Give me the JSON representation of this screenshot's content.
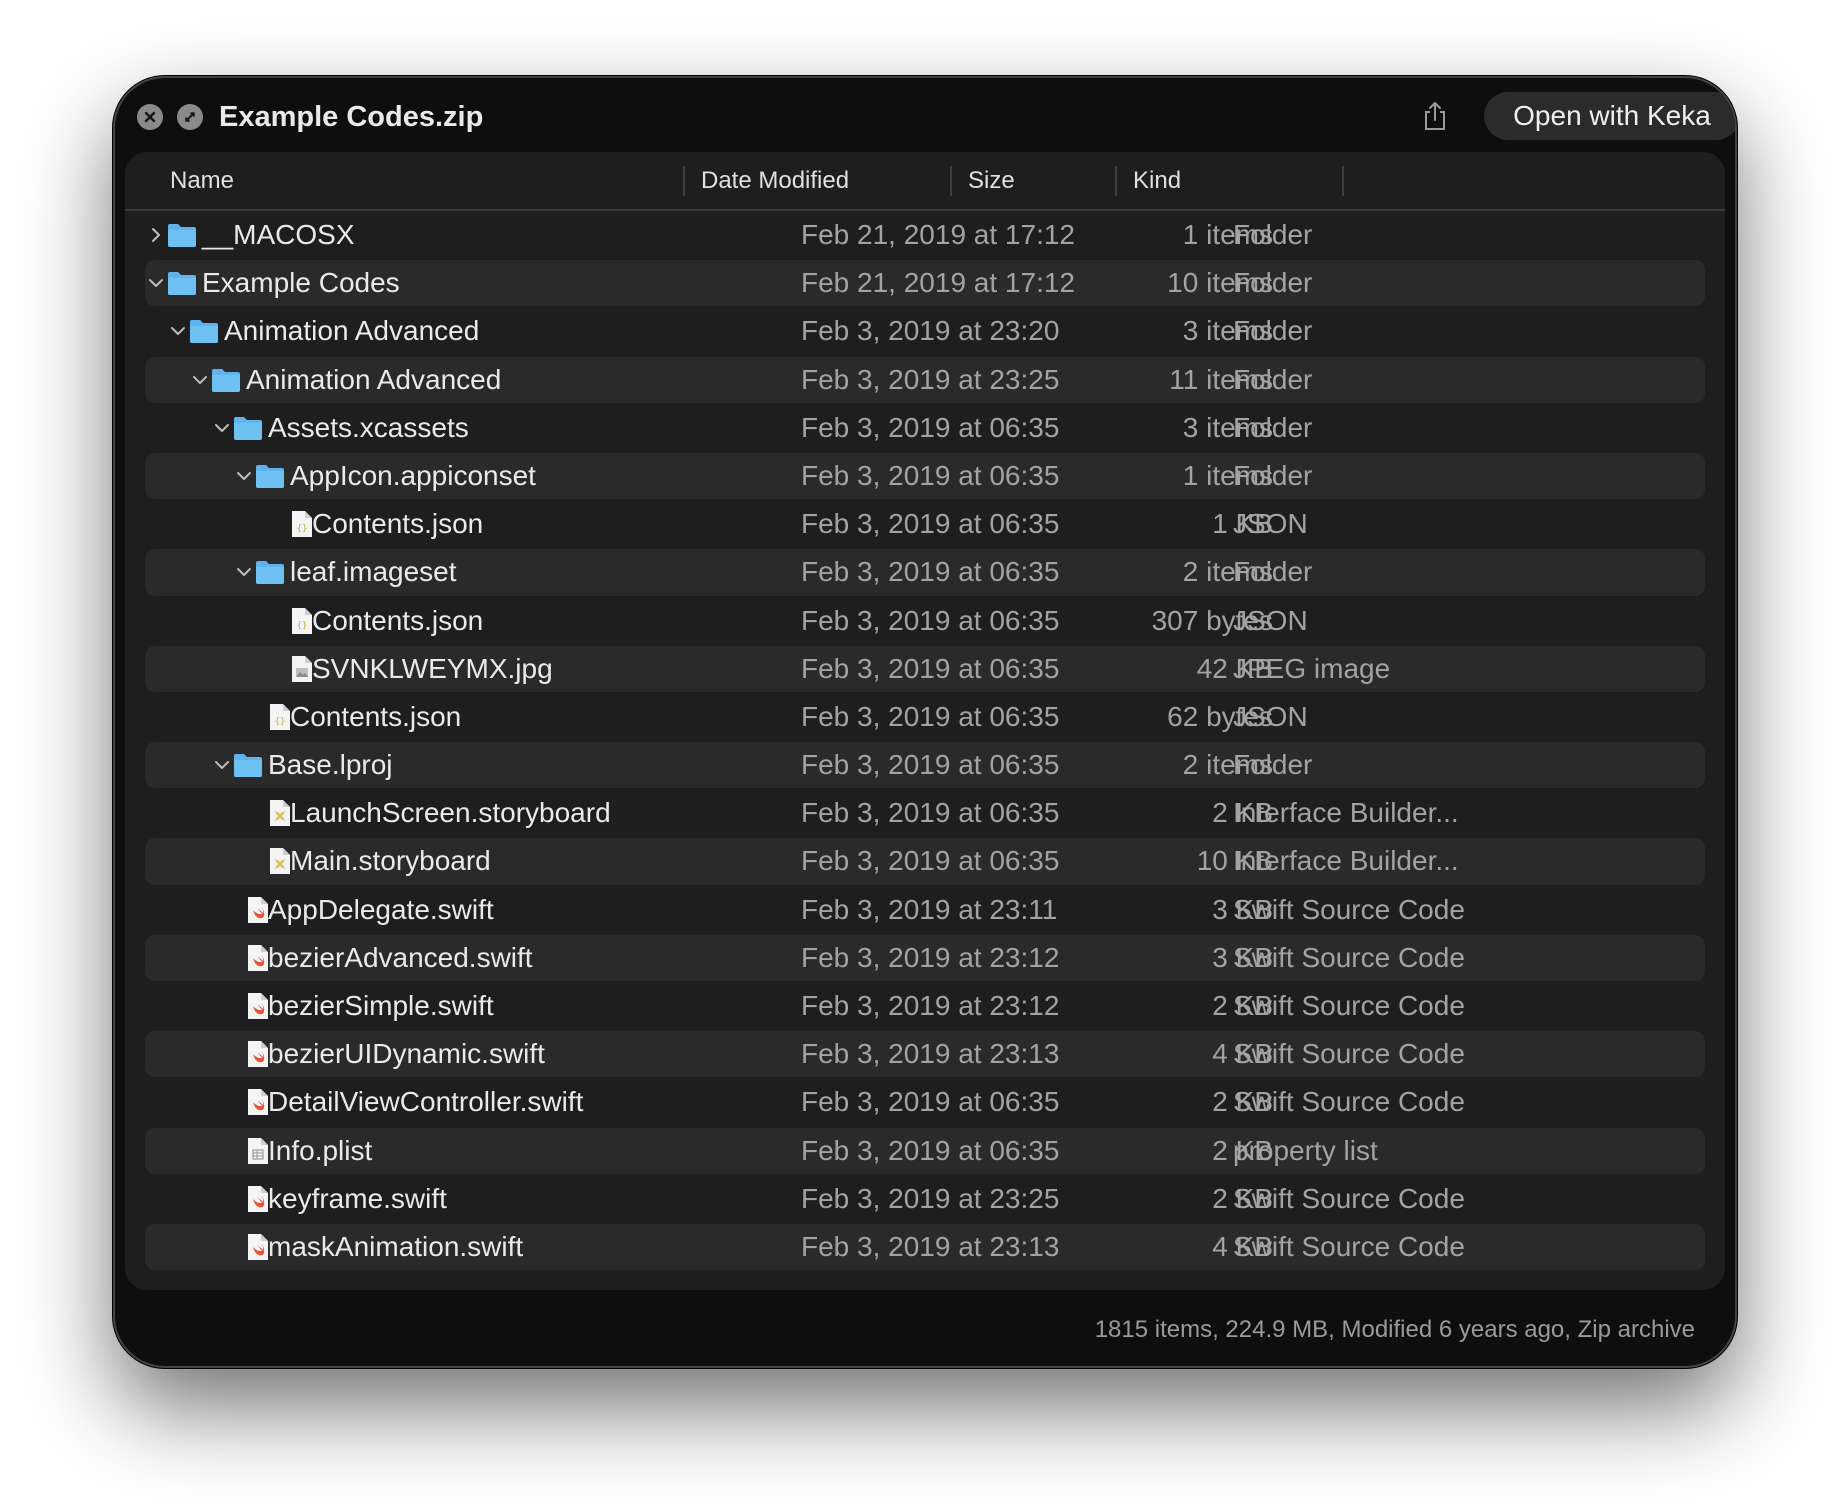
{
  "window": {
    "title": "Example Codes.zip",
    "open_button": "Open with Keka",
    "footer": "1815 items, 224.9 MB, Modified 6 years ago, Zip archive"
  },
  "columns": [
    "Name",
    "Date Modified",
    "Size",
    "Kind"
  ],
  "rows": [
    {
      "name": "__MACOSX",
      "date": "Feb 21, 2019 at 17:12",
      "size": "1 items",
      "kind": "Folder",
      "icon": "folder-icon",
      "level": 0,
      "expand": "collapsed"
    },
    {
      "name": "Example Codes",
      "date": "Feb 21, 2019 at 17:12",
      "size": "10 items",
      "kind": "Folder",
      "icon": "folder-icon",
      "level": 0,
      "expand": "expanded"
    },
    {
      "name": "Animation Advanced",
      "date": "Feb 3, 2019 at 23:20",
      "size": "3 items",
      "kind": "Folder",
      "icon": "folder-icon",
      "level": 1,
      "expand": "expanded"
    },
    {
      "name": "Animation Advanced",
      "date": "Feb 3, 2019 at 23:25",
      "size": "11 items",
      "kind": "Folder",
      "icon": "folder-icon",
      "level": 2,
      "expand": "expanded"
    },
    {
      "name": "Assets.xcassets",
      "date": "Feb 3, 2019 at 06:35",
      "size": "3 items",
      "kind": "Folder",
      "icon": "folder-icon",
      "level": 3,
      "expand": "expanded"
    },
    {
      "name": "AppIcon.appiconset",
      "date": "Feb 3, 2019 at 06:35",
      "size": "1 items",
      "kind": "Folder",
      "icon": "folder-icon",
      "level": 4,
      "expand": "expanded"
    },
    {
      "name": "Contents.json",
      "date": "Feb 3, 2019 at 06:35",
      "size": "1 KB",
      "kind": "JSON",
      "icon": "json-file-icon",
      "level": 5,
      "expand": "none"
    },
    {
      "name": "leaf.imageset",
      "date": "Feb 3, 2019 at 06:35",
      "size": "2 items",
      "kind": "Folder",
      "icon": "folder-icon",
      "level": 4,
      "expand": "expanded"
    },
    {
      "name": "Contents.json",
      "date": "Feb 3, 2019 at 06:35",
      "size": "307 bytes",
      "kind": "JSON",
      "icon": "json-file-icon",
      "level": 5,
      "expand": "none"
    },
    {
      "name": "SVNKLWEYMX.jpg",
      "date": "Feb 3, 2019 at 06:35",
      "size": "42 KB",
      "kind": "JPEG image",
      "icon": "image-file-icon",
      "level": 5,
      "expand": "none"
    },
    {
      "name": "Contents.json",
      "date": "Feb 3, 2019 at 06:35",
      "size": "62 bytes",
      "kind": "JSON",
      "icon": "json-file-icon",
      "level": 4,
      "expand": "none"
    },
    {
      "name": "Base.lproj",
      "date": "Feb 3, 2019 at 06:35",
      "size": "2 items",
      "kind": "Folder",
      "icon": "folder-icon",
      "level": 3,
      "expand": "expanded"
    },
    {
      "name": "LaunchScreen.storyboard",
      "date": "Feb 3, 2019 at 06:35",
      "size": "2 KB",
      "kind": "Interface Builder...",
      "icon": "storyboard-file-icon",
      "level": 4,
      "expand": "none"
    },
    {
      "name": "Main.storyboard",
      "date": "Feb 3, 2019 at 06:35",
      "size": "10 KB",
      "kind": "Interface Builder...",
      "icon": "storyboard-file-icon",
      "level": 4,
      "expand": "none"
    },
    {
      "name": "AppDelegate.swift",
      "date": "Feb 3, 2019 at 23:11",
      "size": "3 KB",
      "kind": "Swift Source Code",
      "icon": "swift-file-icon",
      "level": 3,
      "expand": "none"
    },
    {
      "name": "bezierAdvanced.swift",
      "date": "Feb 3, 2019 at 23:12",
      "size": "3 KB",
      "kind": "Swift Source Code",
      "icon": "swift-file-icon",
      "level": 3,
      "expand": "none"
    },
    {
      "name": "bezierSimple.swift",
      "date": "Feb 3, 2019 at 23:12",
      "size": "2 KB",
      "kind": "Swift Source Code",
      "icon": "swift-file-icon",
      "level": 3,
      "expand": "none"
    },
    {
      "name": "bezierUIDynamic.swift",
      "date": "Feb 3, 2019 at 23:13",
      "size": "4 KB",
      "kind": "Swift Source Code",
      "icon": "swift-file-icon",
      "level": 3,
      "expand": "none"
    },
    {
      "name": "DetailViewController.swift",
      "date": "Feb 3, 2019 at 06:35",
      "size": "2 KB",
      "kind": "Swift Source Code",
      "icon": "swift-file-icon",
      "level": 3,
      "expand": "none"
    },
    {
      "name": "Info.plist",
      "date": "Feb 3, 2019 at 06:35",
      "size": "2 KB",
      "kind": "property list",
      "icon": "plist-file-icon",
      "level": 3,
      "expand": "none"
    },
    {
      "name": "keyframe.swift",
      "date": "Feb 3, 2019 at 23:25",
      "size": "2 KB",
      "kind": "Swift Source Code",
      "icon": "swift-file-icon",
      "level": 3,
      "expand": "none"
    },
    {
      "name": "maskAnimation.swift",
      "date": "Feb 3, 2019 at 23:13",
      "size": "4 KB",
      "kind": "Swift Source Code",
      "icon": "swift-file-icon",
      "level": 3,
      "expand": "none"
    }
  ],
  "colors": {
    "folder": "#5fb4ee",
    "window_bg": "#0e0e0e",
    "panel_bg": "#1e1e1e",
    "alt_row": "#2a2a2a"
  }
}
